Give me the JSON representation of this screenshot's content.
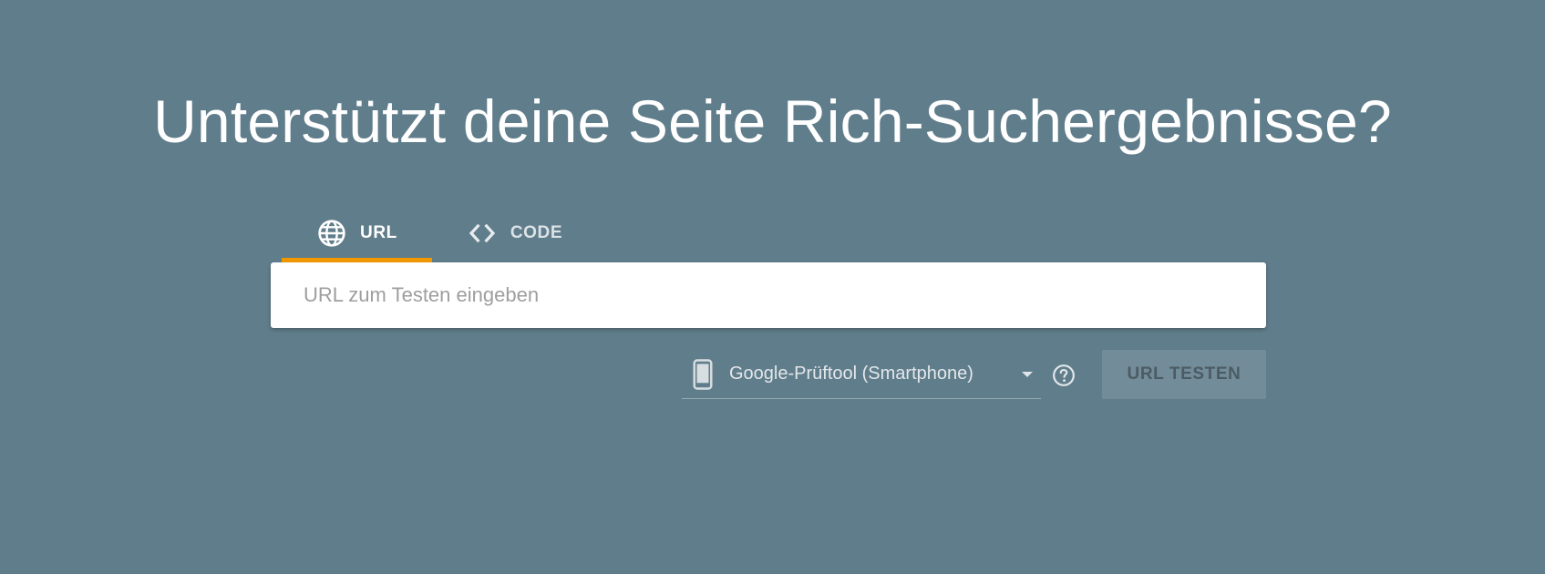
{
  "page": {
    "title": "Unterstützt deine Seite Rich-Suchergebnisse?",
    "background_color": "#607d8b"
  },
  "tabs": [
    {
      "label": "URL",
      "icon": "globe-icon",
      "active": true
    },
    {
      "label": "CODE",
      "icon": "code-icon",
      "active": false
    }
  ],
  "tab_indicator_color": "#f29900",
  "url_input": {
    "placeholder": "URL zum Testen eingeben",
    "value": ""
  },
  "device_select": {
    "icon": "smartphone-icon",
    "selected": "Google-Prüftool (Smartphone)"
  },
  "help": {
    "icon": "help-circle-icon"
  },
  "test_button": {
    "label": "URL TESTEN",
    "enabled": false
  }
}
